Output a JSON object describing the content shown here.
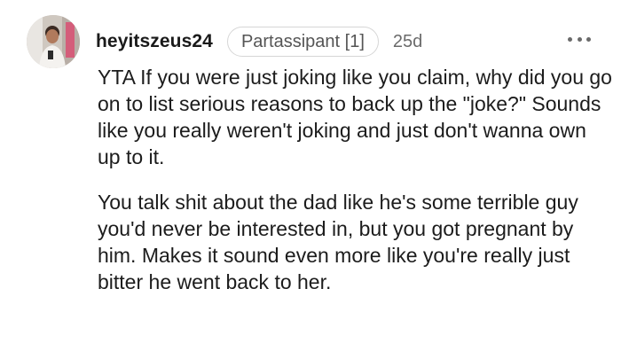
{
  "comment": {
    "author": "heyitszeus24",
    "badge": "Partassipant [1]",
    "age": "25d",
    "avatar_icon": "user-avatar-photo",
    "more_icon": "more-options-icon",
    "paragraphs": [
      "YTA If you were just joking like you claim, why did you go on to list serious reasons to back up the \"joke?\" Sounds like you really weren't joking and just don't wanna own up to it.",
      "You talk shit about the dad like he's some terrible guy you'd never be interested in, but you got pregnant by him. Makes it sound even more like you're really just bitter he went back to her."
    ]
  }
}
